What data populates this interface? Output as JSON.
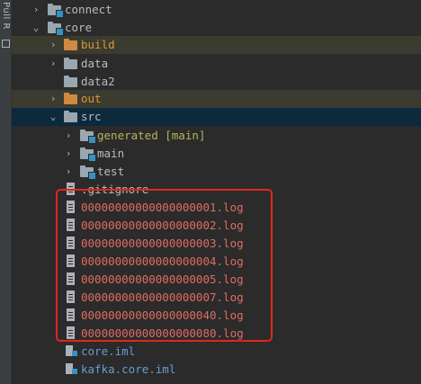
{
  "side_panel": {
    "label": "Pull R"
  },
  "tree": [
    {
      "label": "connect",
      "arrow": "collapsed",
      "icon": "folder-module-icon",
      "color": "default"
    },
    {
      "label": "core",
      "arrow": "expanded",
      "icon": "folder-module-icon",
      "color": "default"
    },
    {
      "label": "build",
      "arrow": "collapsed",
      "icon": "folder-orange-icon",
      "color": "orange"
    },
    {
      "label": "data",
      "arrow": "collapsed",
      "icon": "folder-icon",
      "color": "default"
    },
    {
      "label": "data2",
      "arrow": "none",
      "icon": "folder-icon",
      "color": "default"
    },
    {
      "label": "out",
      "arrow": "collapsed",
      "icon": "folder-orange-icon",
      "color": "orange"
    },
    {
      "label": "src",
      "arrow": "expanded",
      "icon": "folder-icon",
      "color": "default"
    },
    {
      "label": "generated [main]",
      "arrow": "collapsed",
      "icon": "folder-module-icon",
      "color": "olive"
    },
    {
      "label": "main",
      "arrow": "collapsed",
      "icon": "folder-module-icon",
      "color": "default"
    },
    {
      "label": "test",
      "arrow": "collapsed",
      "icon": "folder-module-icon",
      "color": "default"
    },
    {
      "label": ".gitignore",
      "arrow": "none",
      "icon": "file-icon",
      "color": "default"
    },
    {
      "label": "00000000000000000001.log",
      "arrow": "none",
      "icon": "file-icon",
      "color": "red"
    },
    {
      "label": "00000000000000000002.log",
      "arrow": "none",
      "icon": "file-icon",
      "color": "red"
    },
    {
      "label": "00000000000000000003.log",
      "arrow": "none",
      "icon": "file-icon",
      "color": "red"
    },
    {
      "label": "00000000000000000004.log",
      "arrow": "none",
      "icon": "file-icon",
      "color": "red"
    },
    {
      "label": "00000000000000000005.log",
      "arrow": "none",
      "icon": "file-icon",
      "color": "red"
    },
    {
      "label": "00000000000000000007.log",
      "arrow": "none",
      "icon": "file-icon",
      "color": "red"
    },
    {
      "label": "00000000000000000040.log",
      "arrow": "none",
      "icon": "file-icon",
      "color": "red"
    },
    {
      "label": "00000000000000000080.log",
      "arrow": "none",
      "icon": "file-icon",
      "color": "red"
    },
    {
      "label": "core.iml",
      "arrow": "none",
      "icon": "iml-file-icon",
      "color": "blue"
    },
    {
      "label": "kafka.core.iml",
      "arrow": "none",
      "icon": "iml-file-icon",
      "color": "blue"
    }
  ],
  "colors": {
    "background": "#2b2b2b",
    "excluded_row": "#3c3b2f",
    "selected_row": "#0d293e",
    "untracked_text": "#e06c62",
    "excluded_text": "#d8983b",
    "generated_text": "#b5b45e",
    "iml_text": "#6b9bd2",
    "highlight_border": "#e0271b"
  }
}
